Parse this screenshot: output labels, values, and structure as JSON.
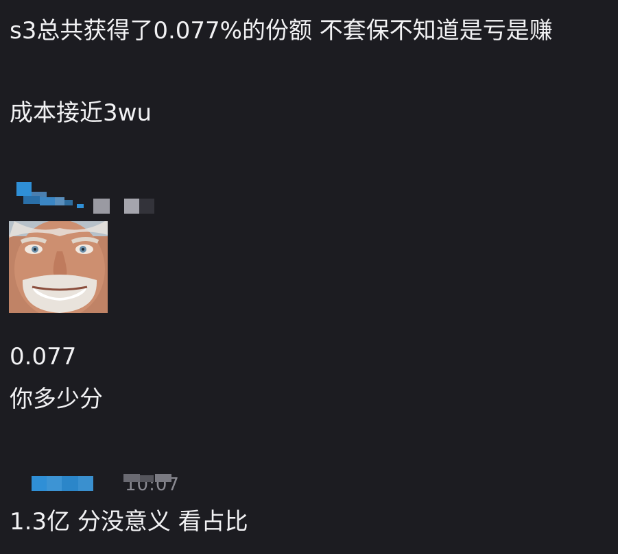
{
  "messages": [
    {
      "text": "s3总共获得了0.077%的份额 不套保不知道是亏是赚"
    },
    {
      "text": "成本接近3wu"
    },
    {
      "text": "0.077\n你多少分"
    },
    {
      "text": "1.3亿 分没意义 看占比"
    }
  ],
  "reply": {
    "timestamp": "10:07"
  },
  "colors": {
    "background": "#1c1c21",
    "text": "#f2f2f4",
    "username_accent": "#2f8fd6",
    "timestamp": "#8a8a92"
  },
  "icons": [
    "pixelated-username",
    "avatar-photo",
    "pixelated-username"
  ]
}
